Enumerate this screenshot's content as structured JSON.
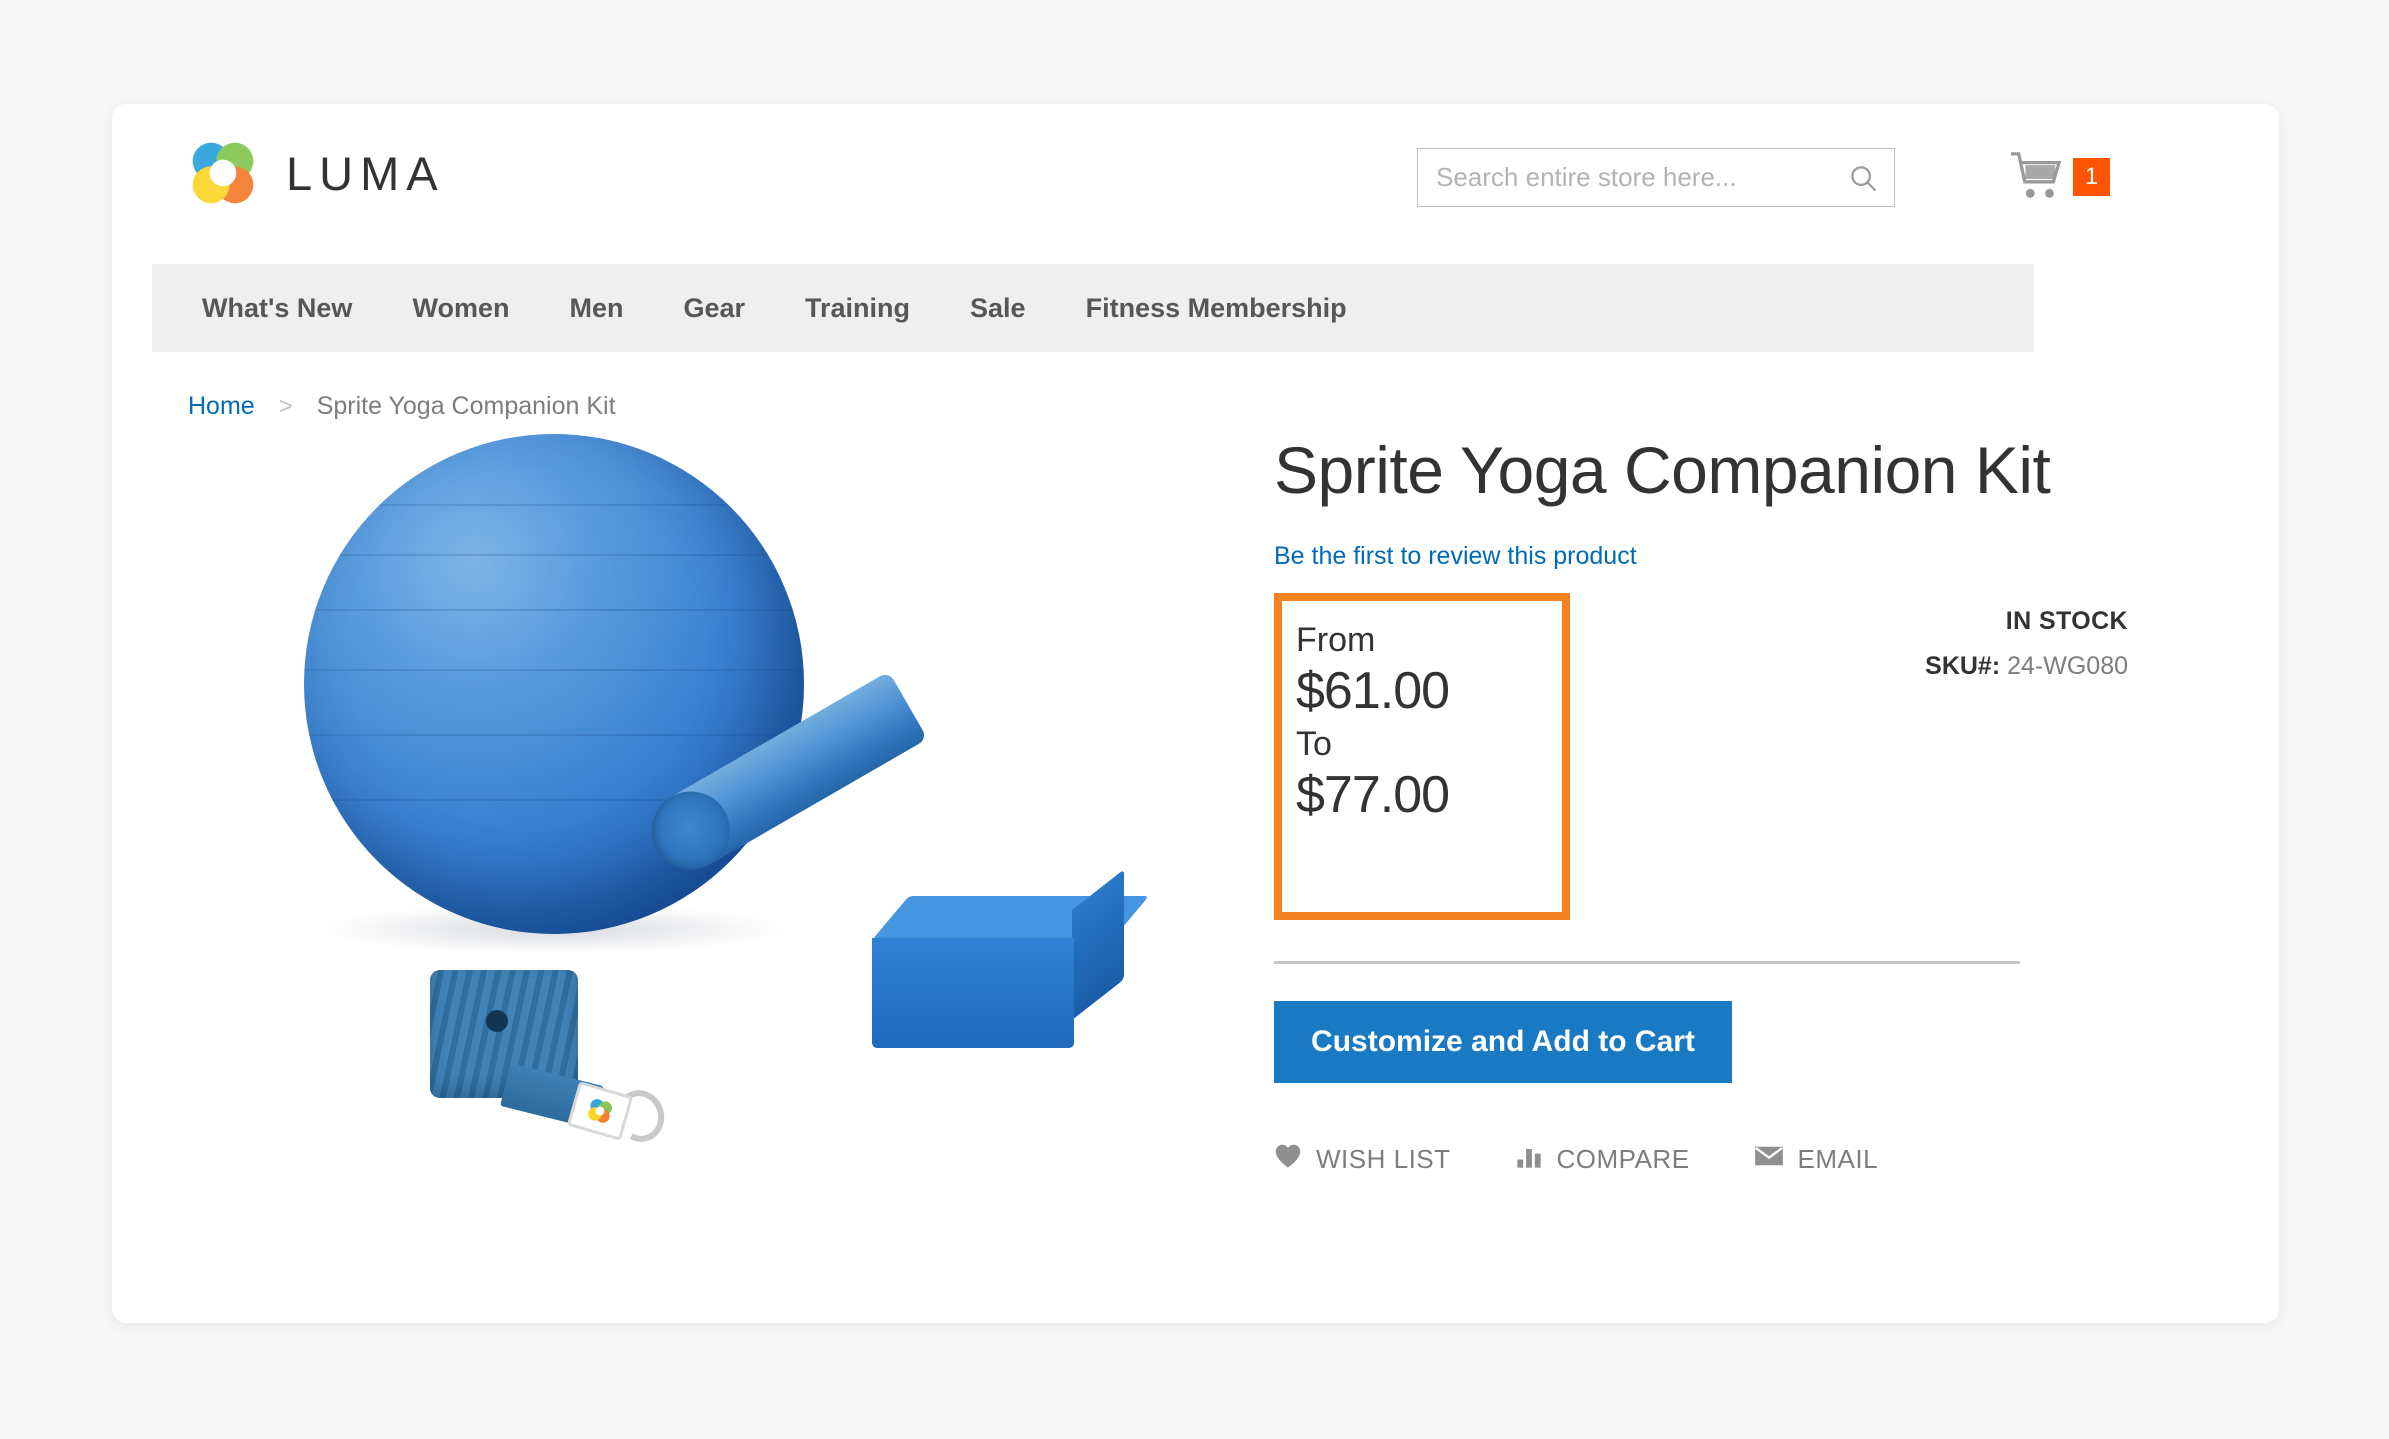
{
  "brand": {
    "name": "LUMA",
    "logo_icon": "luma-ring-logo"
  },
  "search": {
    "placeholder": "Search entire store here...",
    "value": "",
    "icon": "search-icon"
  },
  "cart": {
    "icon": "shopping-cart-icon",
    "count": "1"
  },
  "nav": {
    "items": [
      {
        "label": "What's New"
      },
      {
        "label": "Women"
      },
      {
        "label": "Men"
      },
      {
        "label": "Gear"
      },
      {
        "label": "Training"
      },
      {
        "label": "Sale"
      },
      {
        "label": "Fitness Membership"
      }
    ]
  },
  "breadcrumb": {
    "home": "Home",
    "separator": ">",
    "current": "Sprite Yoga Companion Kit"
  },
  "product": {
    "title": "Sprite Yoga Companion Kit",
    "review_link": "Be the first to review this product",
    "price": {
      "from_label": "From",
      "from_value": "$61.00",
      "to_label": "To",
      "to_value": "$77.00",
      "highlight_color": "#f58220"
    },
    "availability": "IN STOCK",
    "sku_label": "SKU#:",
    "sku_value": "24-WG080",
    "cta_label": "Customize and Add to Cart",
    "cta_color": "#1979c3",
    "actions": [
      {
        "label": "WISH LIST",
        "icon": "heart-icon"
      },
      {
        "label": "COMPARE",
        "icon": "bar-chart-icon"
      },
      {
        "label": "EMAIL",
        "icon": "envelope-icon"
      }
    ],
    "image_alt": "Blue exercise ball, foam roller, yoga block and yoga strap"
  }
}
